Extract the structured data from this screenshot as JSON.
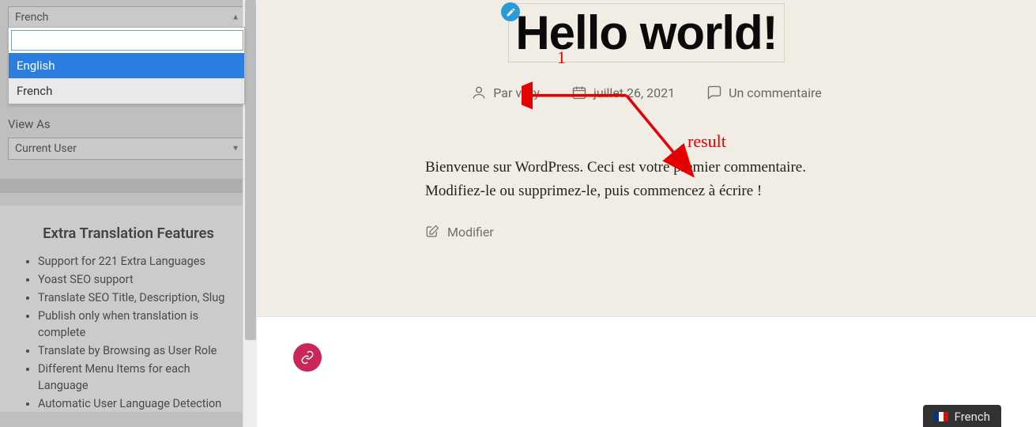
{
  "sidebar": {
    "language_select_value": "French",
    "dropdown": {
      "search_value": "",
      "options": [
        {
          "label": "English",
          "selected": true
        },
        {
          "label": "French",
          "selected": false
        }
      ]
    },
    "view_as_label": "View As",
    "view_as_value": "Current User",
    "features": {
      "title": "Extra Translation Features",
      "items": [
        "Support for 221 Extra Languages",
        "Yoast SEO support",
        "Translate SEO Title, Description, Slug",
        "Publish only when translation is complete",
        "Translate by Browsing as User Role",
        "Different Menu Items for each Language",
        "Automatic User Language Detection"
      ]
    }
  },
  "content": {
    "title": "Hello world!",
    "meta": {
      "author_prefix": "Par",
      "author": "vyvy",
      "date": "juillet 26, 2021",
      "comments": "Un commentaire"
    },
    "body": "Bienvenue sur WordPress. Ceci est votre premier commentaire. Modifiez-le ou supprimez-le, puis commencez à écrire !",
    "edit_label": "Modifier",
    "lang_badge": "French"
  },
  "annotations": {
    "label1": "1",
    "label2": "result"
  }
}
